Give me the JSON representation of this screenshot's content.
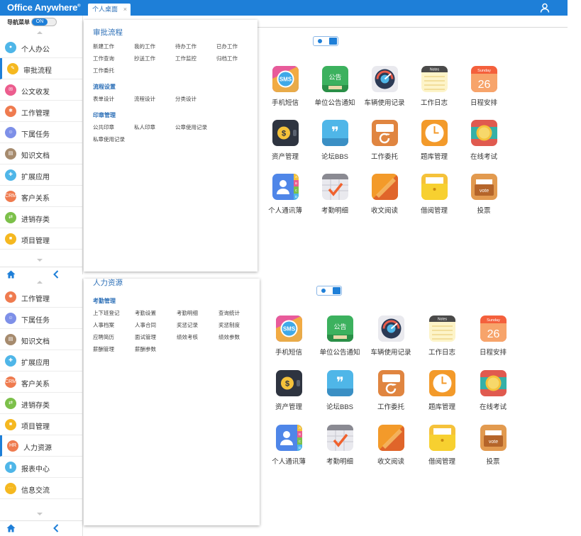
{
  "header": {
    "logo": "Office Anywhere",
    "logo_mark": "®",
    "tab": "个人桌面",
    "tab_close": "×"
  },
  "sidebar": {
    "nav_label": "导航菜单",
    "switch_on": "ON",
    "top_items": [
      {
        "label": "个人办公",
        "icon": "person-icon",
        "color": "#4fb6e8",
        "glyph": "●"
      },
      {
        "label": "审批流程",
        "icon": "pencil-icon",
        "color": "#f5b820",
        "glyph": "✎"
      },
      {
        "label": "公文收发",
        "icon": "doc-icon",
        "color": "#ec5d8e",
        "glyph": "✉"
      },
      {
        "label": "工作管理",
        "icon": "gear-icon",
        "color": "#ef7b4f",
        "glyph": "✱"
      },
      {
        "label": "下属任务",
        "icon": "group-icon",
        "color": "#7e90e8",
        "glyph": "☺"
      },
      {
        "label": "知识文档",
        "icon": "book-icon",
        "color": "#a68b6e",
        "glyph": "▤"
      },
      {
        "label": "扩展应用",
        "icon": "puzzle-icon",
        "color": "#4fb6e8",
        "glyph": "✚"
      },
      {
        "label": "客户关系",
        "icon": "crm-icon",
        "color": "#ef7b4f",
        "glyph": "CRM"
      },
      {
        "label": "进销存类",
        "icon": "cart-icon",
        "color": "#7cc04a",
        "glyph": "⇄"
      },
      {
        "label": "项目管理",
        "icon": "project-icon",
        "color": "#f5b820",
        "glyph": "■"
      }
    ],
    "bottom_items": [
      {
        "label": "工作管理",
        "icon": "gear-icon",
        "color": "#ef7b4f",
        "glyph": "✱"
      },
      {
        "label": "下属任务",
        "icon": "group-icon",
        "color": "#7e90e8",
        "glyph": "☺"
      },
      {
        "label": "知识文档",
        "icon": "book-icon",
        "color": "#a68b6e",
        "glyph": "▤"
      },
      {
        "label": "扩展应用",
        "icon": "puzzle-icon",
        "color": "#4fb6e8",
        "glyph": "✚"
      },
      {
        "label": "客户关系",
        "icon": "crm-icon",
        "color": "#ef7b4f",
        "glyph": "CRM"
      },
      {
        "label": "进销存类",
        "icon": "cart-icon",
        "color": "#7cc04a",
        "glyph": "⇄"
      },
      {
        "label": "项目管理",
        "icon": "project-icon",
        "color": "#f5b820",
        "glyph": "■"
      },
      {
        "label": "人力资源",
        "icon": "hr-icon",
        "color": "#ef7b4f",
        "glyph": "HR"
      },
      {
        "label": "报表中心",
        "icon": "chart-icon",
        "color": "#4fb6e8",
        "glyph": "▮"
      },
      {
        "label": "信息交流",
        "icon": "chat-icon",
        "color": "#f5b820",
        "glyph": "⋯"
      }
    ]
  },
  "popup1": {
    "title": "审批流程",
    "items_row1": [
      "新建工作",
      "我的工作",
      "待办工作",
      "已办工作"
    ],
    "items_row2": [
      "工作查询",
      "抄送工作",
      "工作监控",
      "归档工作"
    ],
    "items_row3": [
      "工作委托"
    ],
    "sec1": "流程设置",
    "sec1_items": [
      "表单设计",
      "流程设计",
      "分类设计"
    ],
    "sec2": "印章管理",
    "sec2_row1": [
      "公共印章",
      "私人印章",
      "公章使用记录"
    ],
    "sec2_row2": [
      "私章使用记录"
    ]
  },
  "popup2": {
    "title": "人力资源",
    "sec1": "考勤管理",
    "rows": [
      [
        "上下班登记",
        "考勤设置",
        "考勤明细",
        "查询统计"
      ],
      [
        "人事档案",
        "人事合同",
        "奖惩记录",
        "奖惩制度"
      ],
      [
        "应聘简历",
        "面试管理",
        "绩效考核",
        "绩效参数"
      ],
      [
        "薪酬管理",
        "薪酬参数"
      ]
    ]
  },
  "apps": [
    {
      "label": "手机短信",
      "icon": "sms-icon"
    },
    {
      "label": "单位公告通知",
      "icon": "notice-board-icon"
    },
    {
      "label": "车辆使用记录",
      "icon": "gauge-icon"
    },
    {
      "label": "工作日志",
      "icon": "notes-icon"
    },
    {
      "label": "日程安排",
      "icon": "calendar-icon"
    },
    {
      "label": "资产管理",
      "icon": "wallet-icon"
    },
    {
      "label": "论坛BBS",
      "icon": "quote-bubble-icon"
    },
    {
      "label": "工作委托",
      "icon": "delegate-icon"
    },
    {
      "label": "题库管理",
      "icon": "clock-icon"
    },
    {
      "label": "在线考试",
      "icon": "watch-icon"
    },
    {
      "label": "个人通讯薄",
      "icon": "contacts-icon"
    },
    {
      "label": "考勤明细",
      "icon": "checklist-icon"
    },
    {
      "label": "收文阅读",
      "icon": "reading-icon"
    },
    {
      "label": "借阅管理",
      "icon": "folder-icon"
    },
    {
      "label": "投票",
      "icon": "vote-box-icon"
    }
  ],
  "icon_text": {
    "sms": "SMS",
    "notice": "公告",
    "notes": "Notes",
    "sunday": "Sunday",
    "day": "26",
    "dollar": "$",
    "vote": "vote",
    "quote": "❞",
    "letters": [
      "A",
      "B",
      "C",
      "D"
    ]
  }
}
